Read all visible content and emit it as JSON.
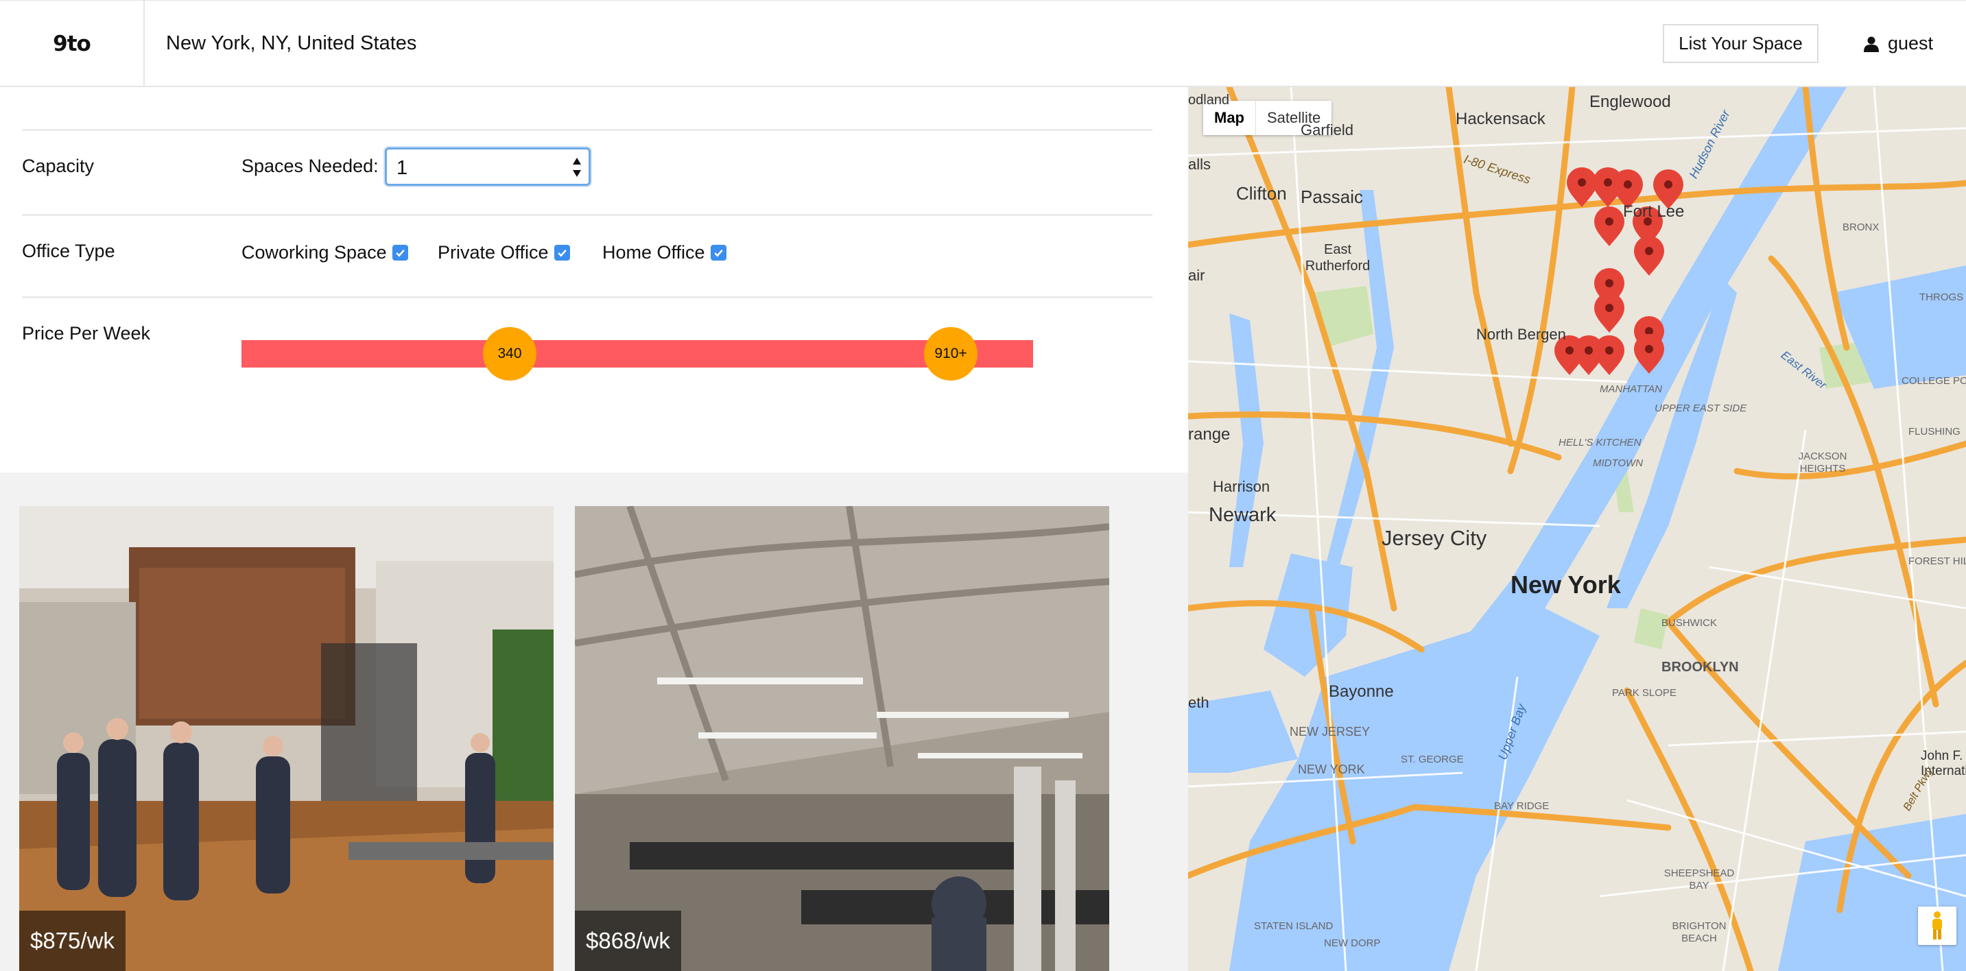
{
  "header": {
    "logo": "9to",
    "location": "New York, NY, United States",
    "list_space_label": "List Your Space",
    "user_label": "guest"
  },
  "filters": {
    "capacity_label": "Capacity",
    "spaces_needed_label": "Spaces Needed:",
    "spaces_needed_value": "1",
    "office_type_label": "Office Type",
    "office_types": [
      {
        "label": "Coworking Space",
        "checked": true
      },
      {
        "label": "Private Office",
        "checked": true
      },
      {
        "label": "Home Office",
        "checked": true
      }
    ],
    "price_label": "Price Per Week",
    "price_min": "340",
    "price_max": "910+",
    "slider_color": "#ff5a5f",
    "thumb_color": "#ffa500"
  },
  "listings": [
    {
      "price": "$875/wk"
    },
    {
      "price": "$868/wk"
    }
  ],
  "map": {
    "map_type_map": "Map",
    "map_type_satellite": "Satellite",
    "labels": {
      "new_york": "New York",
      "jersey_city": "Jersey City",
      "newark": "Newark",
      "hackensack": "Hackensack",
      "englewood": "Englewood",
      "fort_lee": "Fort Lee",
      "clifton": "Clifton",
      "passaic": "Passaic",
      "garfield": "Garfield",
      "east_rutherford": "East Rutherford",
      "north_bergen": "North Bergen",
      "harrison": "Harrison",
      "bayonne": "Bayonne",
      "brooklyn": "BROOKLYN",
      "manhattan": "MANHATTAN",
      "upper_east_side": "UPPER EAST SIDE",
      "hells_kitchen": "HELL'S KITCHEN",
      "midtown": "MIDTOWN",
      "bronx": "BRONX",
      "jackson_heights": "JACKSON HEIGHTS",
      "flushing": "FLUSHING",
      "bushwick": "BUSHWICK",
      "park_slope": "PARK SLOPE",
      "bay_ridge": "BAY RIDGE",
      "sheepshead_bay": "SHEEPSHEAD BAY",
      "brighton_beach": "BRIGHTON BEACH",
      "staten_island": "STATEN ISLAND",
      "new_dorp": "NEW DORP",
      "new_jersey": "NEW JERSEY",
      "new_york_state": "NEW YORK",
      "st_george": "ST. GEORGE",
      "upper_bay": "Upper Bay",
      "east_river": "East River",
      "hudson_river": "Hudson River",
      "college_point": "COLLEGE POINT",
      "forest_hills": "FOREST HILLS",
      "throgs_neck": "THROGS NE",
      "jfk": "John F. International",
      "i80_express": "I-80 Express",
      "belt_pkwy": "Belt Pkwy",
      "orange": "range",
      "halls": "alls",
      "fair": "air",
      "eth": "eth",
      "odland": "odland"
    }
  }
}
